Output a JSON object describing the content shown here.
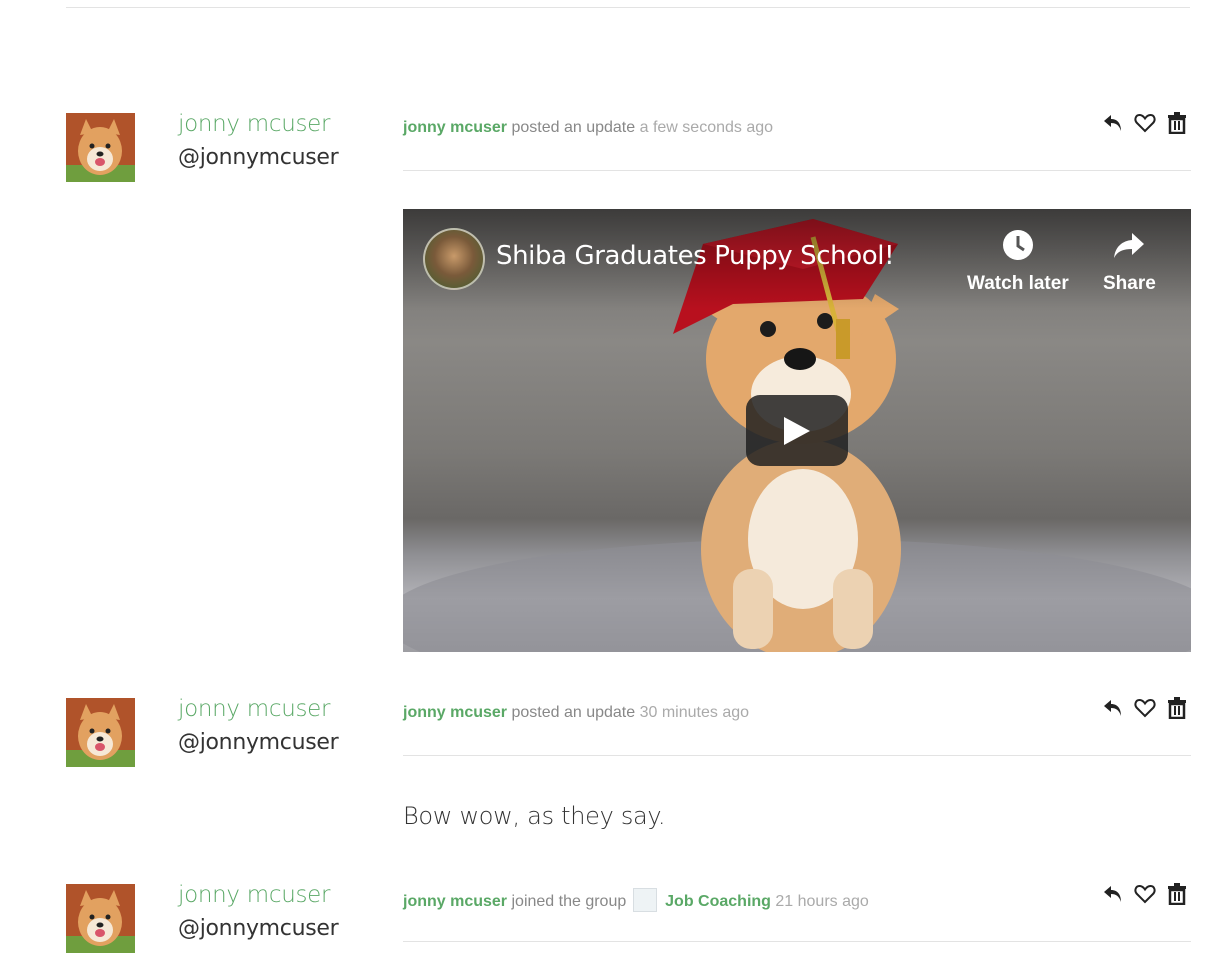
{
  "activities": [
    {
      "user": {
        "name": "jonny mcuser",
        "handle": "@jonnymcuser"
      },
      "meta": {
        "actor": "jonny mcuser",
        "action": "posted an update",
        "when": "a few seconds ago"
      },
      "video": {
        "title": "Shiba Graduates Puppy School!",
        "watch_later_label": "Watch later",
        "share_label": "Share"
      }
    },
    {
      "user": {
        "name": "jonny mcuser",
        "handle": "@jonnymcuser"
      },
      "meta": {
        "actor": "jonny mcuser",
        "action": "posted an update",
        "when": "30 minutes ago"
      },
      "text": "Bow wow, as they say."
    },
    {
      "user": {
        "name": "jonny mcuser",
        "handle": "@jonnymcuser"
      },
      "meta": {
        "actor": "jonny mcuser",
        "action": "joined the group",
        "group": "Job Coaching",
        "when": "21 hours ago"
      }
    }
  ],
  "icons": {
    "reply": "reply-icon",
    "favorite": "heart-icon",
    "delete": "trash-icon"
  },
  "colors": {
    "accent": "#5aa866",
    "muted": "#888888",
    "rule": "#e3e3e3"
  }
}
